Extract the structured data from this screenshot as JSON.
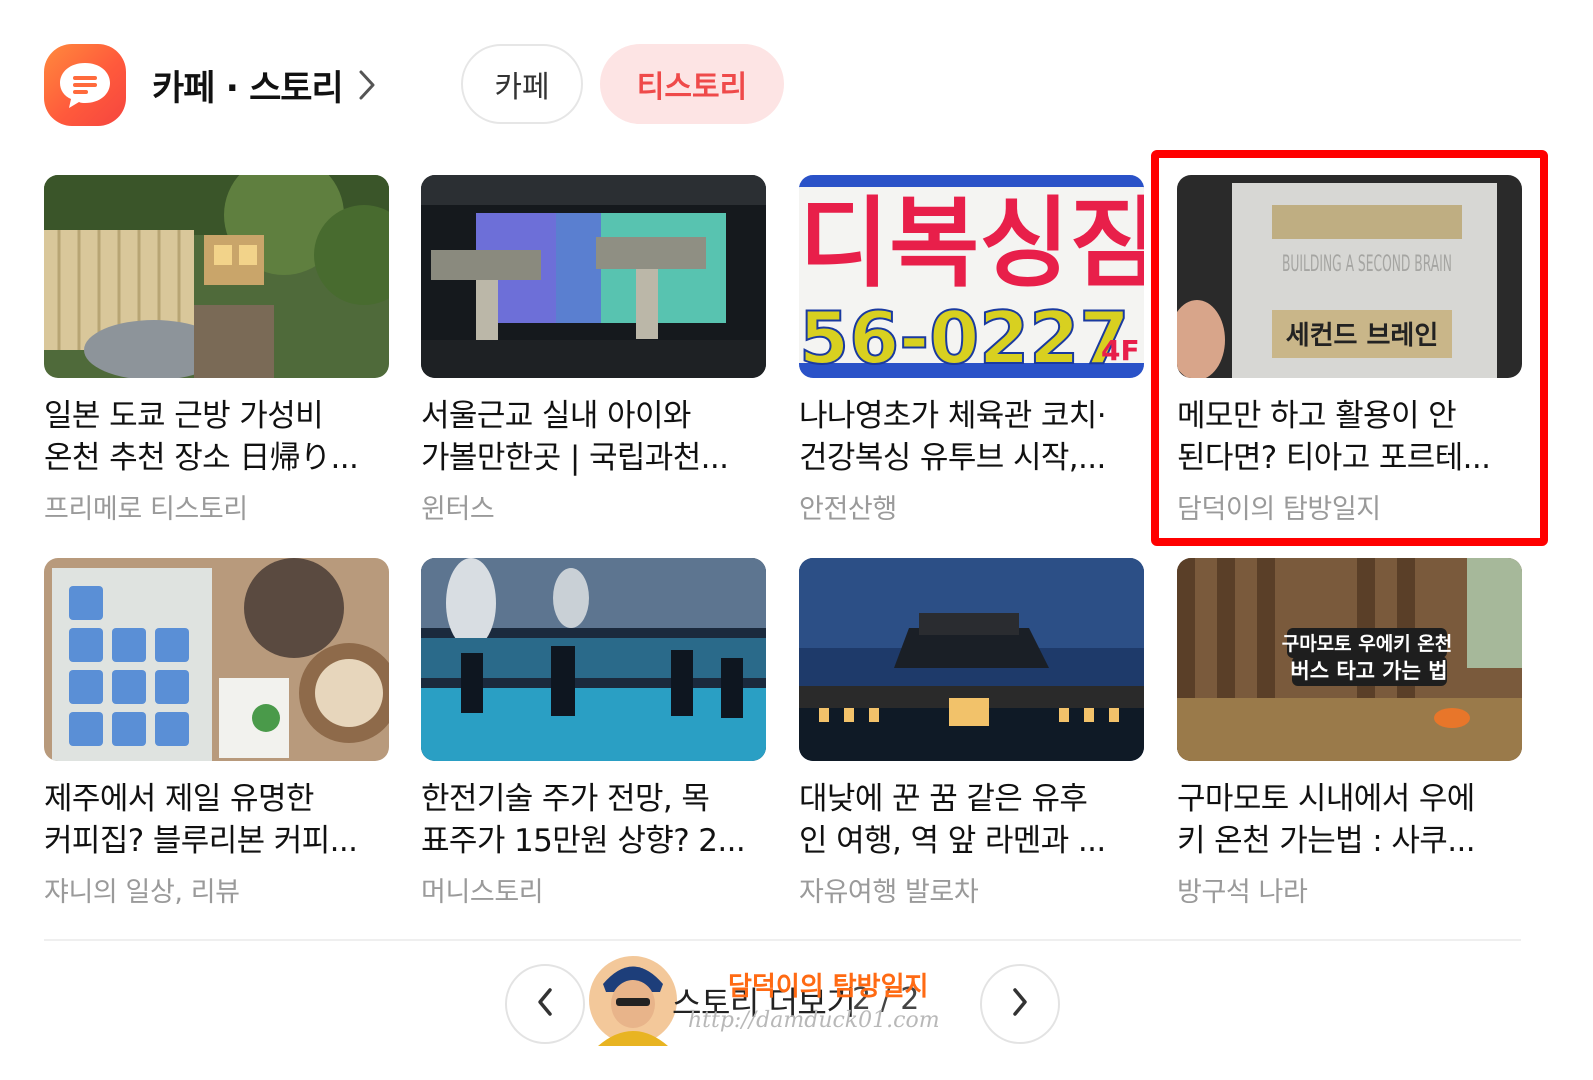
{
  "header": {
    "title": "카페 · 스토리",
    "tabs": [
      {
        "label": "카페",
        "active": false
      },
      {
        "label": "티스토리",
        "active": true
      }
    ]
  },
  "colors": {
    "accent": "#ef4a4a",
    "logo": "#ff6a3c",
    "highlight_box": "#ff0000",
    "source_text": "#9a9a9a"
  },
  "cards": [
    {
      "title_line1": "일본 도쿄 근방 가성비",
      "title_line2": "온천 추천 장소 日帰り...",
      "source": "프리메로 티스토리",
      "image": "garden-onsen-entrance-photo"
    },
    {
      "title_line1": "서울근교 실내 아이와",
      "title_line2": "가볼만한곳 | 국립과천...",
      "source": "윈터스",
      "image": "science-museum-ride-photo"
    },
    {
      "title_line1": "나나영초가 체육관 코치·",
      "title_line2": "건강복싱 유투브 시작,...",
      "source": "안전산행",
      "image": "boxing-gym-sign-photo"
    },
    {
      "title_line1": "메모만 하고 활용이 안",
      "title_line2": "된다면? 티아고 포르테...",
      "source": "담덕이의 탐방일지",
      "image": "second-brain-book-photo",
      "highlighted": true
    },
    {
      "title_line1": "제주에서 제일 유명한",
      "title_line2": "커피집? 블루리본 커피...",
      "source": "쟈니의 일상, 리뷰",
      "image": "coffee-stamp-card-photo"
    },
    {
      "title_line1": "한전기술 주가 전망, 목",
      "title_line2": "표주가 15만원 상향? 2...",
      "source": "머니스토리",
      "image": "power-plant-control-room-photo"
    },
    {
      "title_line1": "대낮에 꾼 꿈 같은 유후",
      "title_line2": "인 여행, 역 앞 라멘과 ...",
      "source": "자유여행 발로차",
      "image": "station-at-dusk-photo"
    },
    {
      "title_line1": "구마모토 시내에서 우에",
      "title_line2": "키 온천 가는법 : 사쿠...",
      "source": "방구석 나라",
      "image": "onsen-bath-photo"
    }
  ],
  "sign_texts": {
    "boxing_sign_top": "디복싱짐",
    "boxing_sign_phone": "56-0227",
    "boxing_sign_floor": "4F",
    "book_en": "BUILDING A SECOND BRAIN",
    "book_ko": "세컨드 브레인",
    "onsen_caption_1": "구마모토 우에키 온천",
    "onsen_caption_2": "버스 타고 가는 법"
  },
  "footer": {
    "more_label": "스토리 더보기",
    "page": "2 / 2",
    "watermark_title": "담덕이의 탐방일지",
    "watermark_url": "http://damduck01.com"
  }
}
